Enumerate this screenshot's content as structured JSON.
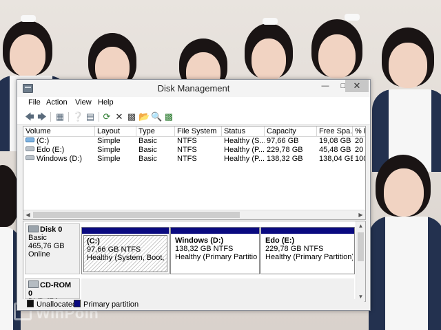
{
  "window": {
    "title": "Disk Management"
  },
  "menu": [
    "File",
    "Action",
    "View",
    "Help"
  ],
  "toolbar": [
    "back-icon",
    "forward-icon",
    "console-tree-icon",
    "help-icon",
    "properties-icon",
    "refresh-icon",
    "delete-icon",
    "connect-icon",
    "open-folder-icon",
    "search-icon",
    "format-icon"
  ],
  "volumes": {
    "headers": [
      "Volume",
      "Layout",
      "Type",
      "File System",
      "Status",
      "Capacity",
      "Free Spa...",
      "% F"
    ],
    "rows": [
      [
        "(C:)",
        "Simple",
        "Basic",
        "NTFS",
        "Healthy (S...",
        "97,66 GB",
        "19,08 GB",
        "20"
      ],
      [
        "Edo (E:)",
        "Simple",
        "Basic",
        "NTFS",
        "Healthy (P...",
        "229,78 GB",
        "45,48 GB",
        "20"
      ],
      [
        "Windows (D:)",
        "Simple",
        "Basic",
        "NTFS",
        "Healthy (P...",
        "138,32 GB",
        "138,04 GB",
        "100"
      ]
    ]
  },
  "disk0": {
    "name": "Disk 0",
    "type": "Basic",
    "size": "465,76 GB",
    "state": "Online",
    "partitions": [
      {
        "name": "(C:)",
        "size": "97,66 GB NTFS",
        "status": "Healthy (System, Boot, Pag"
      },
      {
        "name": "Windows  (D:)",
        "size": "138,32 GB NTFS",
        "status": "Healthy (Primary Partition)"
      },
      {
        "name": "Edo  (E:)",
        "size": "229,78 GB NTFS",
        "status": "Healthy (Primary Partition)"
      }
    ]
  },
  "cdrom": {
    "name": "CD-ROM 0",
    "type": "DVD (F:)"
  },
  "legend": [
    {
      "label": "Unallocated",
      "color": "#111111"
    },
    {
      "label": "Primary partition",
      "color": "#0a0a80"
    }
  ],
  "watermark": "WinPoin"
}
